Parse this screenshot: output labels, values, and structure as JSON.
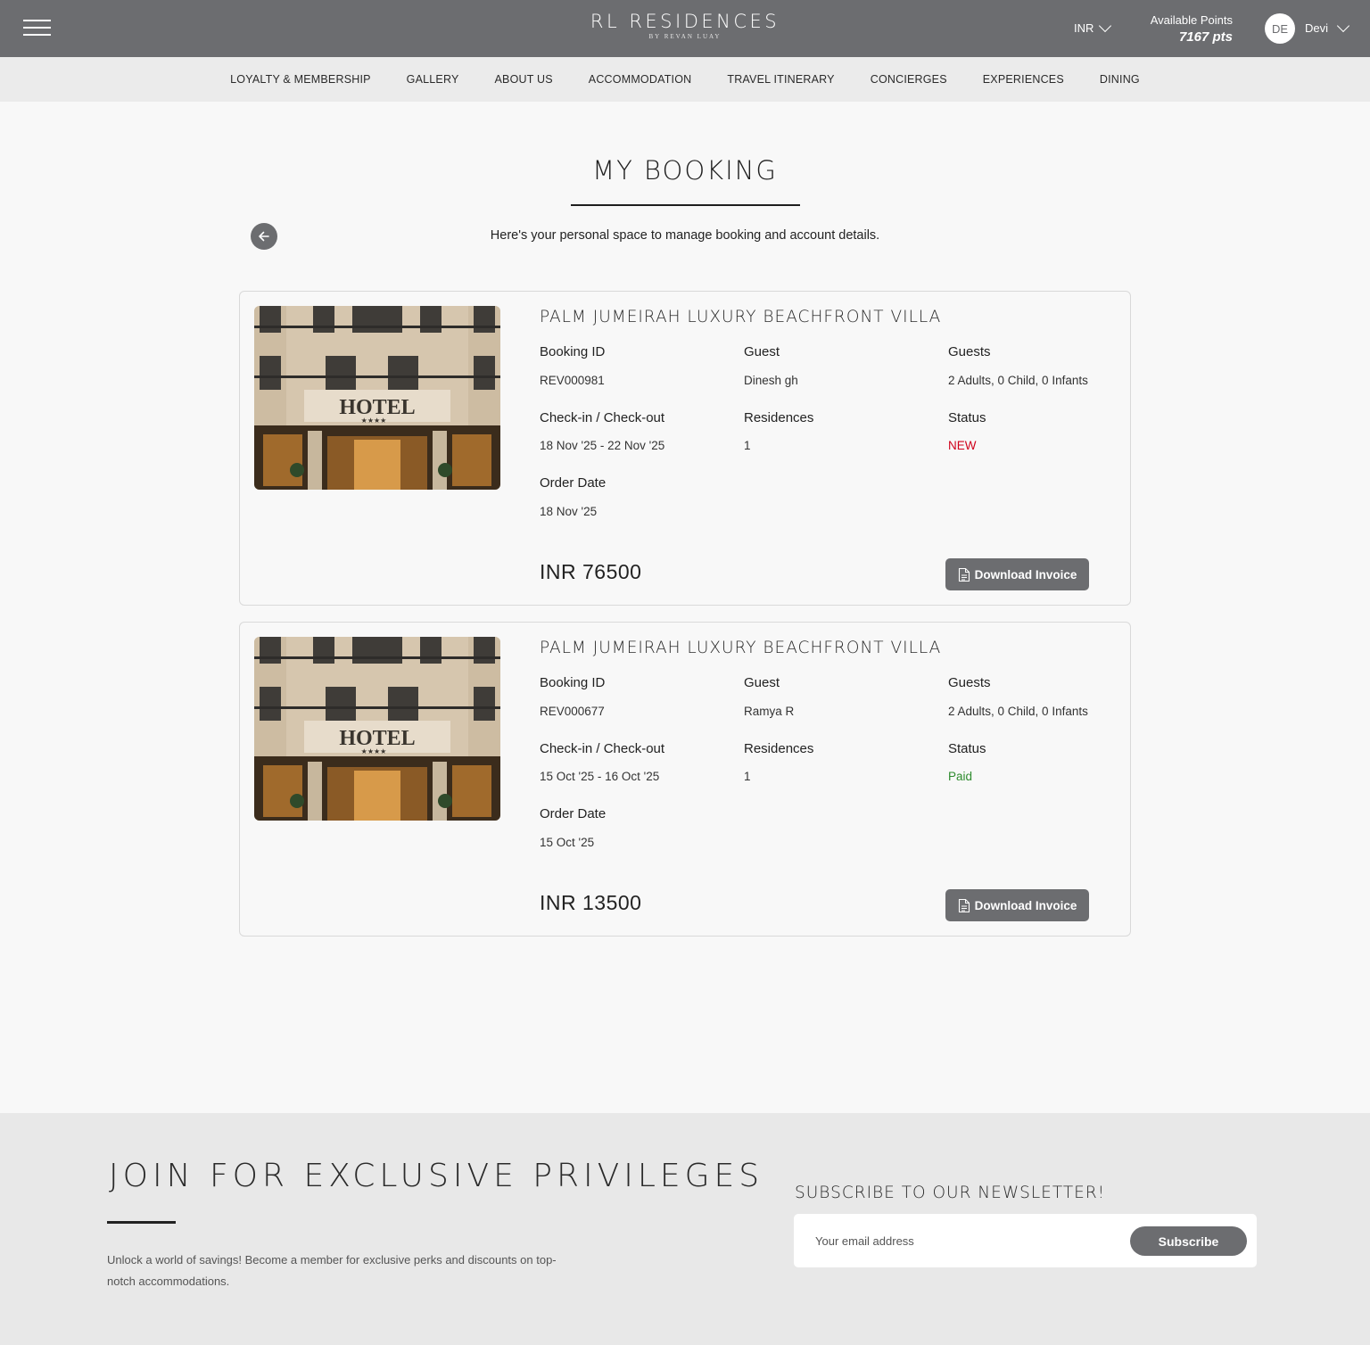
{
  "header": {
    "brand_name": "RL RESIDENCES",
    "brand_sub": "BY REVAN LUAY",
    "currency": "INR",
    "points_label": "Available Points",
    "points_value": "7167 pts",
    "avatar_initials": "DE",
    "user_name": "Devi"
  },
  "nav": [
    {
      "label": "LOYALTY & MEMBERSHIP"
    },
    {
      "label": "GALLERY"
    },
    {
      "label": "ABOUT US"
    },
    {
      "label": "ACCOMMODATION"
    },
    {
      "label": "TRAVEL ITINERARY"
    },
    {
      "label": "CONCIERGES"
    },
    {
      "label": "EXPERIENCES"
    },
    {
      "label": "DINING"
    }
  ],
  "page": {
    "title": "MY BOOKING",
    "subtitle": "Here's your personal space to manage booking and account details."
  },
  "labels": {
    "booking_id": "Booking ID",
    "guest": "Guest",
    "guests": "Guests",
    "checkin": "Check-in / Check-out",
    "residences": "Residences",
    "status": "Status",
    "order_date": "Order Date",
    "download": "Download Invoice",
    "hotel_sign": "HOTEL",
    "hotel_stars": "★★★★"
  },
  "bookings": [
    {
      "title": "PALM JUMEIRAH LUXURY BEACHFRONT VILLA",
      "booking_id": "REV000981",
      "guest": "Dinesh gh",
      "guests": "2 Adults, 0 Child, 0 Infants",
      "dates": "18 Nov '25 - 22 Nov '25",
      "residences": "1",
      "status": "NEW",
      "status_color": "#d0021b",
      "order_date": "18 Nov '25",
      "price": "INR  76500"
    },
    {
      "title": "PALM JUMEIRAH LUXURY BEACHFRONT VILLA",
      "booking_id": "REV000677",
      "guest": "Ramya R",
      "guests": "2 Adults, 0 Child, 0 Infants",
      "dates": "15 Oct '25 - 16 Oct '25",
      "residences": "1",
      "status": "Paid",
      "status_color": "#2e8b2e",
      "order_date": "15 Oct '25",
      "price": "INR  13500"
    }
  ],
  "footer": {
    "join_title": "JOIN FOR EXCLUSIVE PRIVILEGES",
    "join_text": "Unlock a world of savings! Become a member for exclusive perks and discounts on top-notch accommodations.",
    "newsletter_title": "SUBSCRIBE TO OUR NEWSLETTER!",
    "email_placeholder": "Your email address",
    "subscribe_label": "Subscribe"
  },
  "colors": {
    "header_bg": "#6c6d70",
    "nav_bg": "#ebebeb",
    "button": "#6c6d70",
    "footer_bg": "#e8e8e8"
  }
}
